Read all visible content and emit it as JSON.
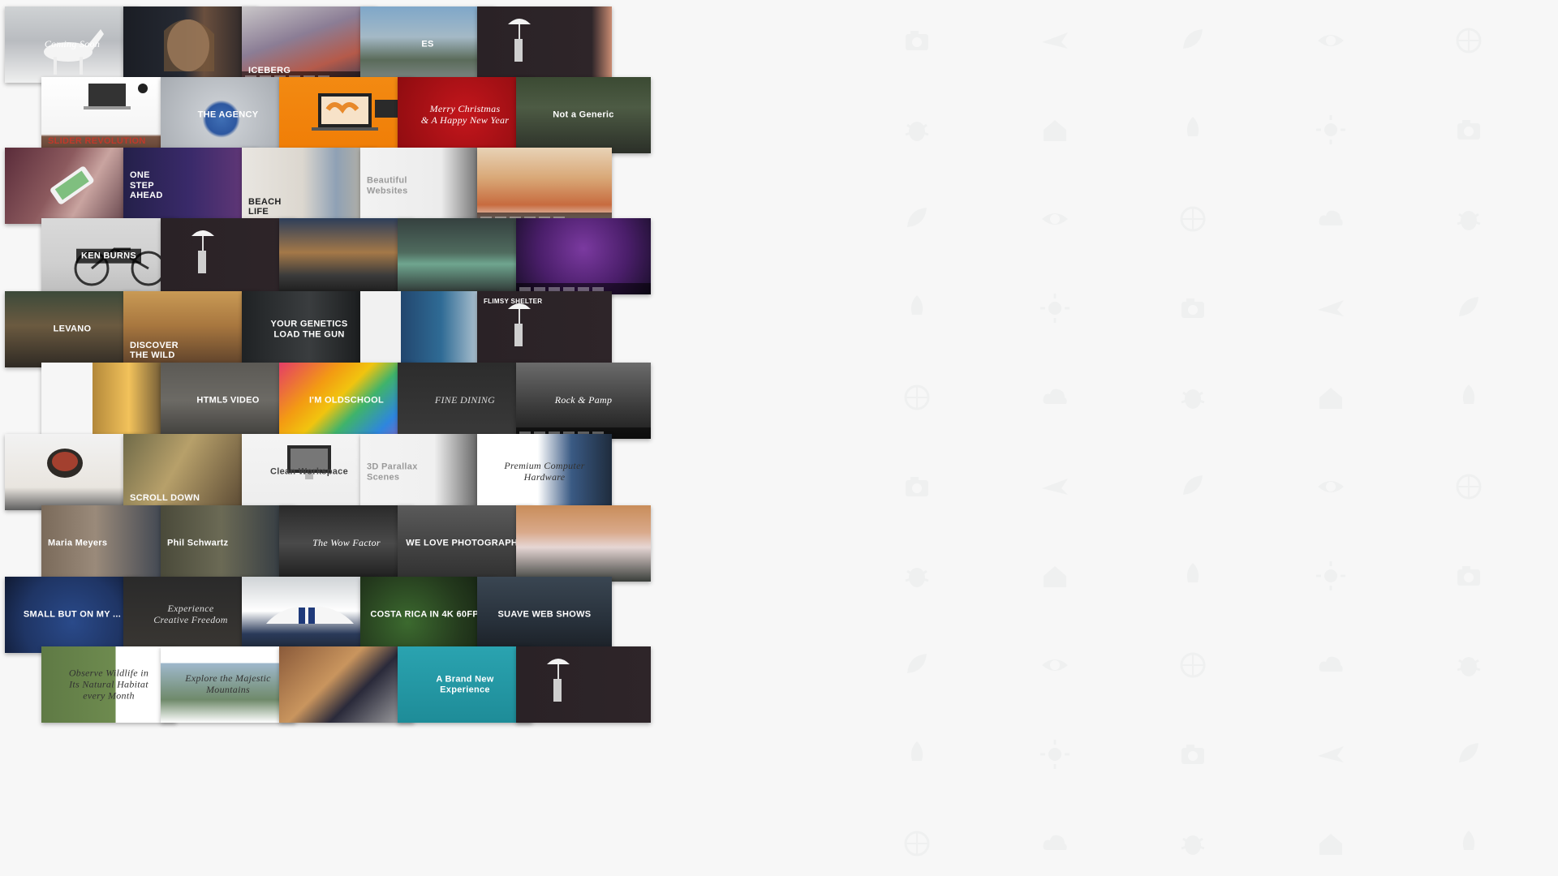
{
  "background_icons": [
    "camera-icon",
    "plane-icon",
    "leaf-icon",
    "eye-icon",
    "globe-icon",
    "cloud-icon",
    "bug-icon",
    "house-icon",
    "rocket-icon",
    "sun-icon"
  ],
  "gallery": {
    "rows": [
      [
        {
          "caption": "Coming Soon",
          "style": "serif",
          "bg": "linear-gradient(180deg,#cfd2d4 0%,#b9bcc0 45%,#efefef 100%)",
          "fg": "#ffffff",
          "deco": "horse"
        },
        {
          "caption": "",
          "style": "",
          "bg": "linear-gradient(90deg,#1a1d24 0%,#262a33 45%,#6a4f3e 60%,#1b1c22 100%)",
          "fg": "#ffffff",
          "deco": "portrait"
        },
        {
          "caption": "ICEBERG",
          "style": "bottom-left",
          "bg": "linear-gradient(160deg,#c9c6c8 0%,#8b7d95 40%,#b55a4a 70%,#2b3a55 100%)",
          "fg": "#ffffff",
          "deco": "bar"
        },
        {
          "caption": "ES",
          "style": "",
          "bg": "linear-gradient(180deg,#7fa7c9 0%,#a4b9c6 40%,#5a6b5a 70%,#828a8a 100%)",
          "fg": "#ffffff",
          "deco": ""
        },
        {
          "caption": "",
          "style": "",
          "bg": "linear-gradient(90deg,#2a2226 0%,#2e2529 85%,#c98b72 100%)",
          "fg": "#ffffff",
          "deco": "umbrella"
        }
      ],
      [
        {
          "caption": "SLIDER REVOLUTION",
          "style": "bottom-left",
          "bg": "linear-gradient(180deg,#ffffff 0%,#f4f4f4 75%,#7a5644 78%,#5e4032 100%)",
          "fg": "#c0392b",
          "deco": "laptop"
        },
        {
          "caption": "THE AGENCY",
          "style": "",
          "bg": "radial-gradient(circle at 45% 55%,#3f6fb5 0%,#2d57a0 18%,#c7cbd0 22%,#9fa4aa 100%)",
          "fg": "#ffffff",
          "deco": ""
        },
        {
          "caption": "",
          "style": "",
          "bg": "linear-gradient(180deg,#f38a12 0%,#f07d06 100%)",
          "fg": "#ffffff",
          "deco": "laptop-orange"
        },
        {
          "caption": "Merry Christmas\n& A Happy New Year",
          "style": "serif",
          "bg": "radial-gradient(circle at 50% 50%,#c4161c 0%,#8e0c10 100%)",
          "fg": "#ffffff",
          "deco": ""
        },
        {
          "caption": "Not a Generic",
          "style": "",
          "bg": "linear-gradient(180deg,#3b4a33 0%,#4d5b44 40%,#2b2f28 100%)",
          "fg": "#ffffff",
          "deco": ""
        }
      ],
      [
        {
          "caption": "",
          "style": "",
          "bg": "linear-gradient(120deg,#5a2c3a 0%,#8c5a5e 40%,#c9a4a0 60%,#4a2b35 100%)",
          "fg": "#ffffff",
          "deco": "phone"
        },
        {
          "caption": "ONE\nSTEP\nAHEAD",
          "style": "left",
          "bg": "linear-gradient(90deg,#24204a 0%,#3a2a6a 50%,#6a3a7a 100%)",
          "fg": "#ffffff",
          "deco": ""
        },
        {
          "caption": "BEACH\nLIFE",
          "style": "bottom-left",
          "bg": "linear-gradient(90deg,#e9e6e1 0%,#dcd7cf 45%,#8fa1b5 70%,#c4b79f 100%)",
          "fg": "#222222",
          "deco": ""
        },
        {
          "caption": "Beautiful\nWebsites",
          "style": "left",
          "bg": "linear-gradient(90deg,#f2f2f2 0%,#ececec 60%,#3b3b3b 100%)",
          "fg": "#9a9a9a",
          "deco": ""
        },
        {
          "caption": "",
          "style": "",
          "bg": "linear-gradient(180deg,#e8d2b6 0%,#d9a877 40%,#c76b3f 75%,#f2f2f2 100%)",
          "fg": "#ffffff",
          "deco": "bar"
        }
      ],
      [
        {
          "caption": "KEN BURNS",
          "style": "boxed",
          "bg": "linear-gradient(180deg,#d9d9d9 0%,#cfcfcf 60%,#bdbdbd 100%)",
          "fg": "#ffffff",
          "deco": "bike"
        },
        {
          "caption": "",
          "style": "",
          "bg": "linear-gradient(90deg,#2a2226 0%,#2e2529 100%)",
          "fg": "#ffffff",
          "deco": "umbrella"
        },
        {
          "caption": "",
          "style": "",
          "bg": "linear-gradient(180deg,#2d3e5a 0%,#a47848 45%,#3b3b3b 75%,#1a1a1a 100%)",
          "fg": "#ffffff",
          "deco": ""
        },
        {
          "caption": "",
          "style": "",
          "bg": "linear-gradient(180deg,#35403f 0%,#4f6b5e 45%,#6fa58f 60%,#2a2f2e 100%)",
          "fg": "#ffffff",
          "deco": ""
        },
        {
          "caption": "",
          "style": "",
          "bg": "radial-gradient(circle at 50% 40%,#7b3aa0 0%,#4a1e6a 55%,#1a0f2a 100%)",
          "fg": "#ffffff",
          "deco": "bar"
        }
      ],
      [
        {
          "caption": "LEVANO",
          "style": "",
          "bg": "linear-gradient(180deg,#3c4a3a 0%,#6b5a40 45%,#2f2a24 100%)",
          "fg": "#ffffff",
          "deco": ""
        },
        {
          "caption": "DISCOVER\nTHE WILD",
          "style": "bottom-left",
          "bg": "linear-gradient(180deg,#c99a55 0%,#a8773f 45%,#5a3f2a 100%)",
          "fg": "#ffffff",
          "deco": ""
        },
        {
          "caption": "YOUR GENETICS\nLOAD THE GUN",
          "style": "",
          "bg": "linear-gradient(90deg,#1f2224 0%,#3a3d3f 50%,#121415 100%)",
          "fg": "#ffffff",
          "deco": ""
        },
        {
          "caption": "",
          "style": "",
          "bg": "linear-gradient(90deg,#f1f1f1 0%,#f1f1f1 30%,#22466e 30%,#2f6b95 60%,#e6e9ea 100%)",
          "fg": "#ffffff",
          "deco": ""
        },
        {
          "caption": "FLIMSY SHELTER",
          "style": "top-left",
          "bg": "linear-gradient(90deg,#2a2226 0%,#2e2529 100%)",
          "fg": "#ffffff",
          "deco": "umbrella"
        }
      ],
      [
        {
          "caption": "",
          "style": "",
          "bg": "linear-gradient(90deg,#f6f6f6 0%,#f6f6f6 38%,#b3883a 38%,#f2c25b 65%,#3a2f27 100%)",
          "fg": "#ffffff",
          "deco": ""
        },
        {
          "caption": "HTML5 VIDEO",
          "style": "",
          "bg": "linear-gradient(180deg,#5c5a55 0%,#6c6a65 50%,#3e3d3a 100%)",
          "fg": "#ffffff",
          "deco": ""
        },
        {
          "caption": "I'M OLDSCHOOL",
          "style": "",
          "bg": "linear-gradient(135deg,#e43c67 0%,#f39c12 30%,#f1c40f 45%,#3fb36b 60%,#2e86de 80%,#9b59b6 100%)",
          "fg": "#ffffff",
          "deco": ""
        },
        {
          "caption": "FINE DINING",
          "style": "serif",
          "bg": "linear-gradient(180deg,#2c2c2c 0%,#3a3a3a 100%)",
          "fg": "#dddddd",
          "deco": ""
        },
        {
          "caption": "Rock & Pamp",
          "style": "serif",
          "bg": "linear-gradient(180deg,#6b6b6b 0%,#3a3a3a 60%,#1c1c1c 100%)",
          "fg": "#ffffff",
          "deco": "bar"
        }
      ],
      [
        {
          "caption": "",
          "style": "",
          "bg": "linear-gradient(180deg,#f2f2f2 0%,#e9e5df 70%,#5e5e5e 100%)",
          "fg": "#ffffff",
          "deco": "bowl"
        },
        {
          "caption": "SCROLL DOWN",
          "style": "bottom-left",
          "bg": "linear-gradient(120deg,#6f6a48 0%,#b7a06a 40%,#4a3a2a 100%)",
          "fg": "#ffffff",
          "deco": ""
        },
        {
          "caption": "Clean Workspace",
          "style": "",
          "bg": "linear-gradient(180deg,#f4f4f4 0%,#ededed 100%)",
          "fg": "#444444",
          "deco": "monitor"
        },
        {
          "caption": "3D Parallax\nScenes",
          "style": "left",
          "bg": "linear-gradient(90deg,#f3f3f3 0%,#f0f0f0 55%,#2f2f2f 100%)",
          "fg": "#9a9a9a",
          "deco": ""
        },
        {
          "caption": "Premium Computer\nHardware",
          "style": "serif",
          "bg": "linear-gradient(90deg,#ffffff 0%,#ffffff 45%,#3a5a84 70%,#1f2c3d 100%)",
          "fg": "#333333",
          "deco": ""
        }
      ],
      [
        {
          "caption": "Maria Meyers",
          "style": "left",
          "bg": "linear-gradient(90deg,#7a6a5a 0%,#9a8a7a 40%,#2f3a4a 100%)",
          "fg": "#ffffff",
          "deco": ""
        },
        {
          "caption": "Phil Schwartz",
          "style": "left",
          "bg": "linear-gradient(90deg,#4a4a3a 0%,#6b6a55 45%,#2a3340 100%)",
          "fg": "#ffffff",
          "deco": ""
        },
        {
          "caption": "The Wow Factor",
          "style": "serif",
          "bg": "linear-gradient(180deg,#2a2a2a 0%,#4a4a4a 50%,#1a1a1a 100%)",
          "fg": "#ffffff",
          "deco": ""
        },
        {
          "caption": "WE LOVE PHOTOGRAPHY",
          "style": "",
          "bg": "linear-gradient(180deg,#5a5a5a 0%,#2f2f2f 100%)",
          "fg": "#ffffff",
          "deco": ""
        },
        {
          "caption": "",
          "style": "",
          "bg": "linear-gradient(180deg,#c98d5a 0%,#d9a98a 35%,#e6d6d4 55%,#3a3e3a 100%)",
          "fg": "#ffffff",
          "deco": ""
        }
      ],
      [
        {
          "caption": "SMALL BUT ON MY ...",
          "style": "",
          "bg": "radial-gradient(circle at 50% 60%,#2a4a8a 0%,#1f3565 60%,#101a33 100%)",
          "fg": "#ffffff",
          "deco": ""
        },
        {
          "caption": "Experience\nCreative Freedom",
          "style": "serif",
          "bg": "linear-gradient(180deg,#2a2a2a 0%,#3a3733 100%)",
          "fg": "#dddddd",
          "deco": ""
        },
        {
          "caption": "",
          "style": "",
          "bg": "linear-gradient(180deg,#cfd3d6 0%,#ffffff 45%,#2a3a5a 75%,#1d2530 100%)",
          "fg": "#ffffff",
          "deco": "car"
        },
        {
          "caption": "COSTA RICA IN 4K 60FPS",
          "style": "",
          "bg": "radial-gradient(circle at 35% 60%,#3c6a2f 0%,#243a1d 55%,#121d10 100%)",
          "fg": "#ffffff",
          "deco": ""
        },
        {
          "caption": "SUAVE WEB SHOWS",
          "style": "",
          "bg": "linear-gradient(180deg,#3a4652 0%,#27303a 60%,#1a1f25 100%)",
          "fg": "#ffffff",
          "deco": ""
        }
      ],
      [
        {
          "caption": "Observe Wildlife in\nIts Natural Habitat\nevery Month",
          "style": "serif",
          "bg": "linear-gradient(90deg,#5f7a45 0%,#6e8b4f 55%,#ffffff 55%,#ffffff 100%)",
          "fg": "#333333",
          "deco": ""
        },
        {
          "caption": "Explore the Majestic\nMountains",
          "style": "serif",
          "bg": "linear-gradient(180deg,#ffffff 0%,#ffffff 22%,#9fb8cc 22%,#6f8a6a 70%,#ffffff 100%)",
          "fg": "#333333",
          "deco": ""
        },
        {
          "caption": "",
          "style": "",
          "bg": "linear-gradient(135deg,#8a5a3a 0%,#c9955e 40%,#2a2a3a 60%,#b0b0b0 100%)",
          "fg": "#ffffff",
          "deco": ""
        },
        {
          "caption": "A Brand New\nExperience",
          "style": "",
          "bg": "linear-gradient(180deg,#2aa3b0 0%,#1e8c98 100%)",
          "fg": "#ffffff",
          "deco": ""
        },
        {
          "caption": "",
          "style": "",
          "bg": "linear-gradient(90deg,#2a2226 0%,#2e2529 100%)",
          "fg": "#ffffff",
          "deco": "umbrella"
        }
      ]
    ]
  }
}
